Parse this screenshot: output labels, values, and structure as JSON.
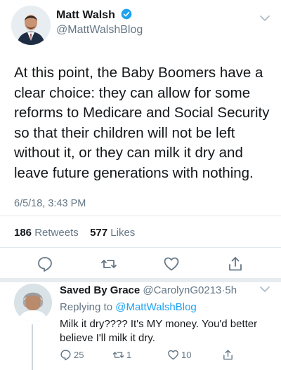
{
  "tweet": {
    "author_name": "Matt Walsh",
    "handle": "@MattWalshBlog",
    "text": "At this point, the Baby Boomers have a clear choice: they can allow for some reforms to Medicare and Social Security so that their children will not be left without it, or they can milk it dry and leave future generations with nothing.",
    "timestamp": "6/5/18, 3:43 PM",
    "retweets_count": "186",
    "retweets_label": "Retweets",
    "likes_count": "577",
    "likes_label": "Likes"
  },
  "reply": {
    "author_name": "Saved By Grace",
    "handle": "@CarolynG0213",
    "separator": "·",
    "time": "5h",
    "replying_prefix": "Replying to",
    "replying_to": "@MattWalshBlog",
    "text": "Milk it dry???? It's MY money. You'd better believe I'll milk it dry.",
    "reply_count": "25",
    "retweet_count": "1",
    "like_count": "10"
  },
  "icons": {
    "reply": "reply-icon",
    "retweet": "retweet-icon",
    "like": "heart-icon",
    "share": "share-icon",
    "verified": "verified-badge-icon",
    "more": "chevron-down-icon"
  },
  "colors": {
    "text": "#14171a",
    "muted": "#657786",
    "accent": "#1da1f2",
    "divider": "#e1e8ed"
  }
}
